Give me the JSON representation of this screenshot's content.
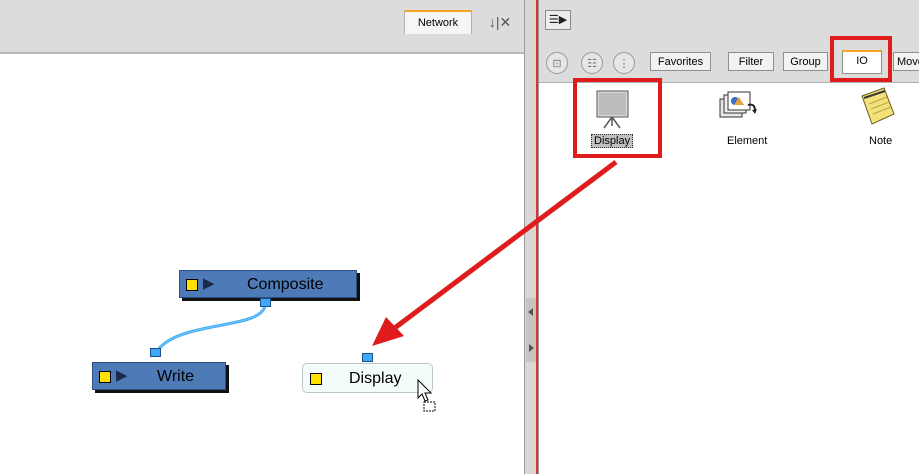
{
  "network_panel": {
    "tab_label": "Network",
    "tab_controls": "↓|✕",
    "nodes": {
      "composite": "Composite",
      "write": "Write",
      "display": "Display"
    }
  },
  "library_panel": {
    "tabs": [
      "Favorites",
      "Filter",
      "Group",
      "IO",
      "Move"
    ],
    "active_tab": "IO",
    "items": [
      "Display",
      "Element",
      "Note"
    ]
  },
  "colors": {
    "node_blue": "#4f7ab8",
    "highlight_red": "#e01b1b",
    "port_blue": "#3fa9f5",
    "tab_accent": "#f5a623"
  }
}
